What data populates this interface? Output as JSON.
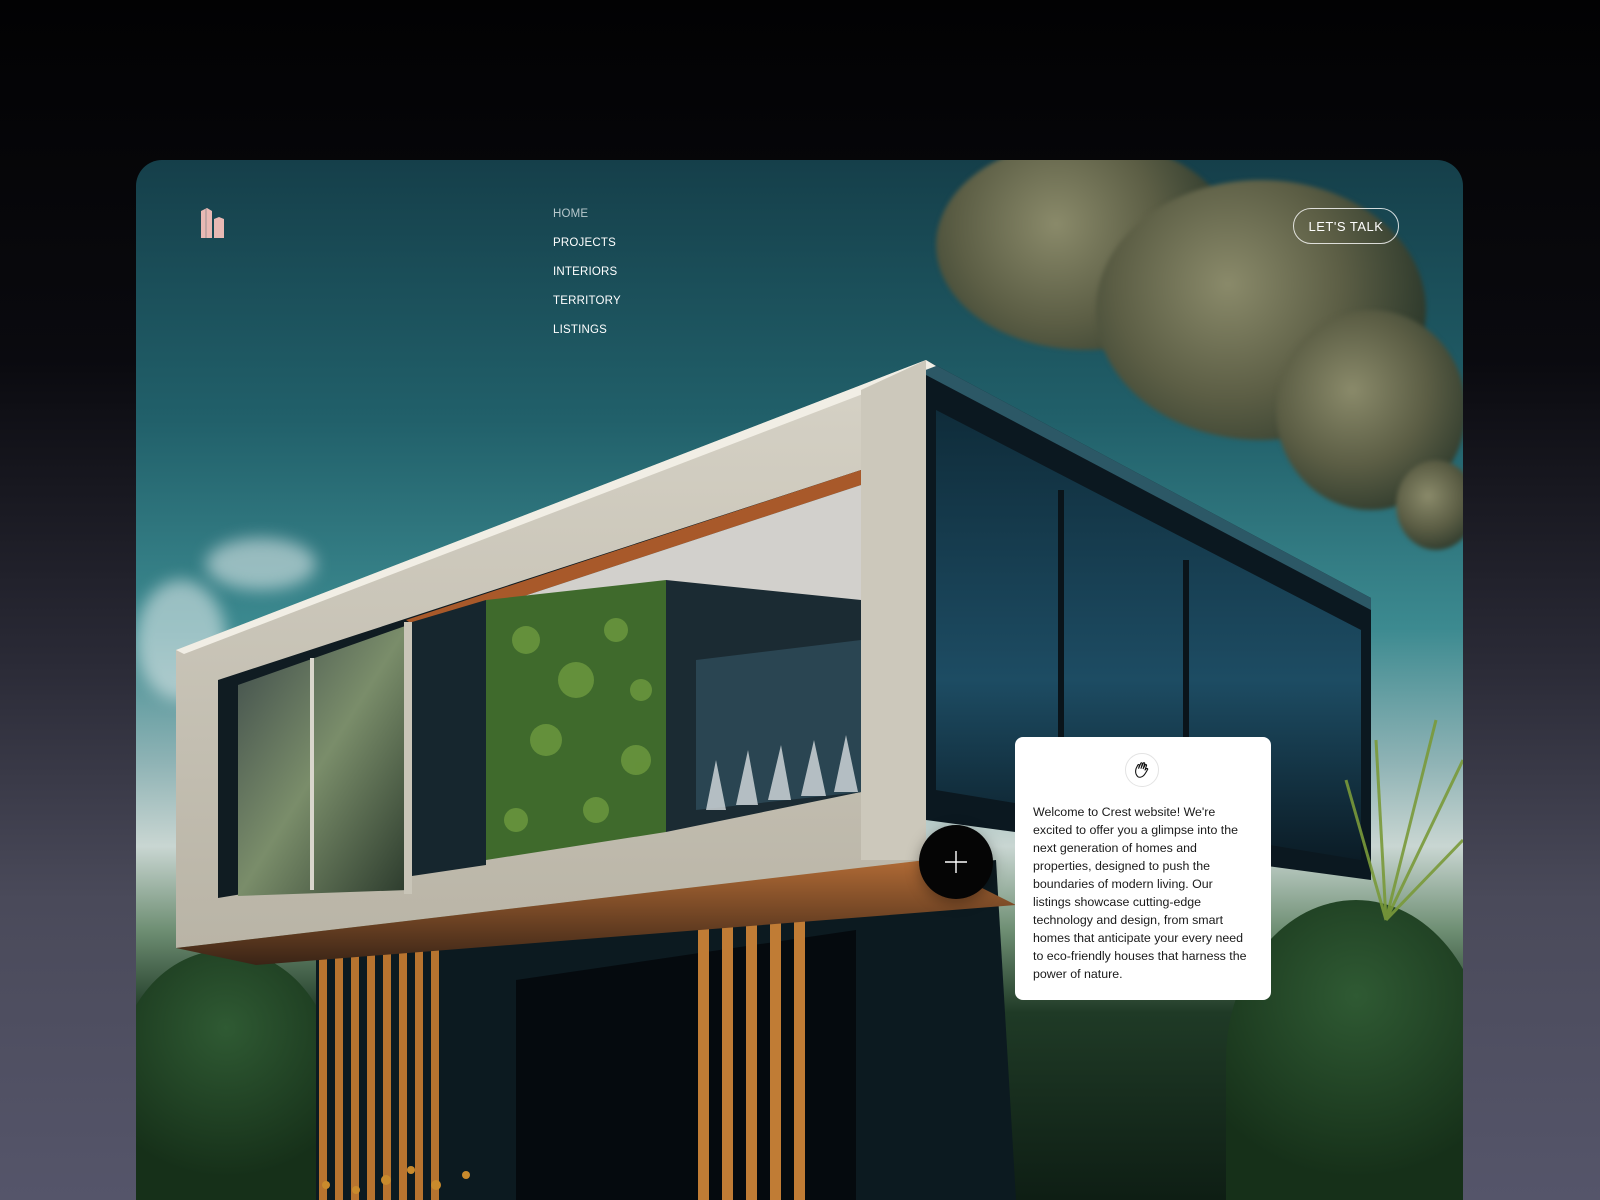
{
  "brand": {
    "logo_icon": "building-logo-icon",
    "logo_color": "#e8b9b4"
  },
  "nav": {
    "items": [
      {
        "label": "HOME",
        "active": true
      },
      {
        "label": "PROJECTS",
        "active": false
      },
      {
        "label": "INTERIORS",
        "active": false
      },
      {
        "label": "TERRITORY",
        "active": false
      },
      {
        "label": "LISTINGS",
        "active": false
      }
    ]
  },
  "cta": {
    "label": "LET'S TALK"
  },
  "hero": {
    "plus_icon": "plus-icon"
  },
  "welcome_card": {
    "icon": "waving-hand-icon",
    "text": "Welcome to Crest website! We're excited to offer you a glimpse into the next generation of homes and properties, designed to push the boundaries of modern living. Our listings showcase cutting-edge technology and design, from smart homes that anticipate your every need to eco-friendly houses that harness the power of nature."
  }
}
